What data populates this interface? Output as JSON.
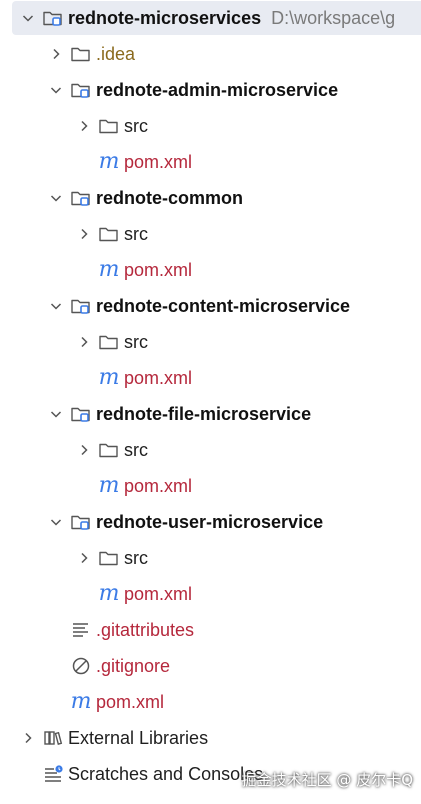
{
  "tree": {
    "root": {
      "label": "rednote-microservices",
      "path": "D:\\workspace\\g"
    },
    "idea": {
      "label": ".idea"
    },
    "modules": [
      {
        "label": "rednote-admin-microservice",
        "src": "src",
        "pom": "pom.xml"
      },
      {
        "label": "rednote-common",
        "src": "src",
        "pom": "pom.xml"
      },
      {
        "label": "rednote-content-microservice",
        "src": "src",
        "pom": "pom.xml"
      },
      {
        "label": "rednote-file-microservice",
        "src": "src",
        "pom": "pom.xml"
      },
      {
        "label": "rednote-user-microservice",
        "src": "src",
        "pom": "pom.xml"
      }
    ],
    "gitattributes": {
      "label": ".gitattributes"
    },
    "gitignore": {
      "label": ".gitignore"
    },
    "root_pom": {
      "label": "pom.xml"
    },
    "external_libraries": {
      "label": "External Libraries"
    },
    "scratches": {
      "label": "Scratches and Consoles"
    }
  },
  "icons": {
    "chevron_expanded": "chevron-down-icon",
    "chevron_collapsed": "chevron-right-icon",
    "folder": "folder-icon",
    "module": "module-folder-icon",
    "maven": "maven-icon",
    "text_file": "text-file-icon",
    "ignore": "gitignore-icon",
    "libraries": "libraries-icon",
    "scratches": "scratches-icon"
  },
  "maven_glyph": "m",
  "colors": {
    "selection": "#e8ebf2",
    "xml_text": "#b5283c",
    "idea_text": "#8a6a1d",
    "module_icon": "#3b7be6",
    "path_text": "#7a7a7a"
  },
  "watermark": "掘金技术社区 @ 皮尔卡Q"
}
